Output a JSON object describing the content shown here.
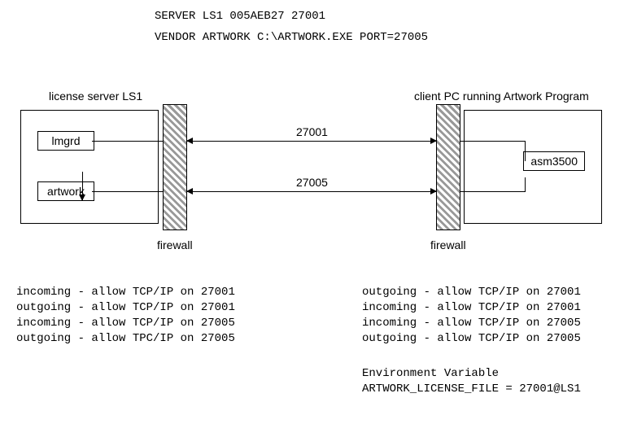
{
  "header": {
    "line1": "SERVER LS1 005AEB27  27001",
    "line2": "VENDOR ARTWORK C:\\ARTWORK.EXE PORT=27005"
  },
  "diagram": {
    "server_label": "license server LS1",
    "client_label": "client PC running Artwork Program",
    "lmgrd": "lmgrd",
    "artwork": "artwork",
    "asm": "asm3500",
    "firewall_label_server": "firewall",
    "firewall_label_client": "firewall",
    "port_27001": "27001",
    "port_27005": "27005"
  },
  "rules_server": "incoming - allow TCP/IP on 27001\noutgoing - allow TCP/IP on 27001\nincoming - allow TCP/IP on 27005\noutgoing - allow TPC/IP on 27005",
  "rules_client": "outgoing - allow TCP/IP on 27001\nincoming - allow TCP/IP on 27001\nincoming - allow TCP/IP on 27005\noutgoing - allow TCP/IP on 27005",
  "env_var": "Environment Variable\nARTWORK_LICENSE_FILE = 27001@LS1"
}
